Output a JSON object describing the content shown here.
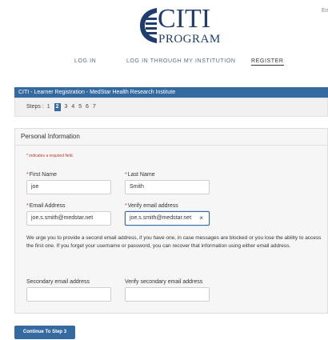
{
  "header": {
    "logo_main": "CITI",
    "logo_sub": "PROGRAM",
    "lang_label": "En"
  },
  "nav": {
    "login": "LOG IN",
    "institution": "LOG IN THROUGH MY INSTITUTION",
    "register": "REGISTER"
  },
  "banner": {
    "title": "CITI - Learner Registration - MedStar Health Research Institute"
  },
  "steps": {
    "label": "Steps :",
    "items": [
      "1",
      "2",
      "3",
      "4",
      "5",
      "6",
      "7"
    ],
    "current": "2"
  },
  "personal_info": {
    "heading": "Personal Information",
    "required_note": "* indicates a required field.",
    "required_marker": "*",
    "first_name_label": "First Name",
    "first_name_value": "joe",
    "last_name_label": "Last Name",
    "last_name_value": "Smith",
    "email_label": "Email Address",
    "email_value": "joe.s.smith@medstar.net",
    "verify_email_label": "Verify email address",
    "verify_email_value": "joe.s.smith@medstar.net",
    "clear_symbol": "×",
    "paragraph": "We urge you to provide a second email address, if you have one, in case messages are blocked or you lose the ability to access the first one. If you forget your username or password, you can recover that information using either email address.",
    "secondary_email_label": "Secondary email address",
    "secondary_email_value": "",
    "verify_secondary_label": "Verify secondary email address",
    "verify_secondary_value": ""
  },
  "actions": {
    "continue_label": "Continue To Step 3"
  },
  "colors": {
    "brand_blue": "#356aa0",
    "logo_navy": "#1f3d6e",
    "required_red": "#c0392b"
  }
}
